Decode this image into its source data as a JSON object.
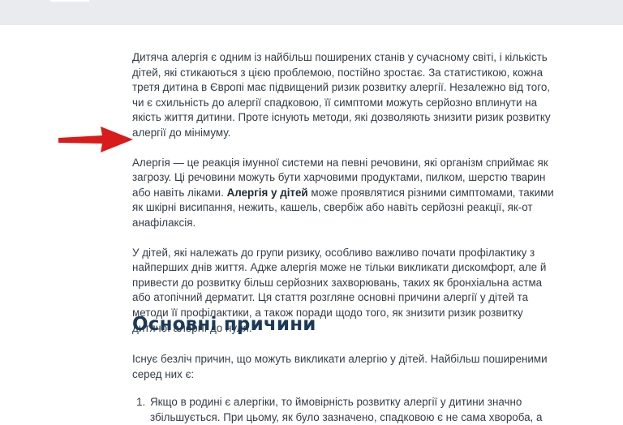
{
  "article": {
    "intro": "Дитяча алергія є одним із найбільш поширених станів у сучасному світі, і кількість дітей, які стикаються з цією проблемою, постійно зростає. За статистикою, кожна третя дитина в Європі має підвищений ризик розвитку алергії. Незалежно від того, чи є схильність до алергії спадковою, її симптоми можуть серйозно вплинути на якість життя дитини. Проте існують методи, які дозволяють знизити ризик розвитку алергії до мінімуму.",
    "p2_before": "Алергія — це реакція імунної системи на певні речовини, які організм сприймає як загрозу. Ці речовини можуть бути харчовими продуктами, пилком, шерстю тварин або навіть ліками. ",
    "p2_bold": "Алергія у дітей",
    "p2_after": " може проявлятися різними симптомами, такими як шкірні висипання, нежить, кашель, свербіж або навіть серйозні реакції, як-от анафілаксія.",
    "p3": "У дітей, які належать до групи ризику, особливо важливо почати профілактику з найперших днів життя. Адже алергія може не тільки викликати дискомфорт, але й привести до розвитку більш серйозних захворювань, таких як бронхіальна астма або атопічний дерматит. Ця стаття розгляне основні причини алергії у дітей та методи її профілактики, а також поради щодо того, як знизити ризик розвитку дитячої алергії до нуля."
  },
  "section": {
    "heading": "Основні причини",
    "lead": "Існує безліч причин, що можуть викликати алергію у дітей. Найбільш поширеними серед них є:",
    "items": [
      "Якщо в родині є алергіки, то ймовірність розвитку алергії у дитини значно збільшується. При цьому, як було зазначено, спадковою є не сама хвороба, а"
    ]
  },
  "colors": {
    "arrow": "#d81b1b",
    "heading": "#1b3a57",
    "top_bar": "#e9ebee"
  },
  "icons": {
    "pointer": "red-arrow-icon"
  }
}
